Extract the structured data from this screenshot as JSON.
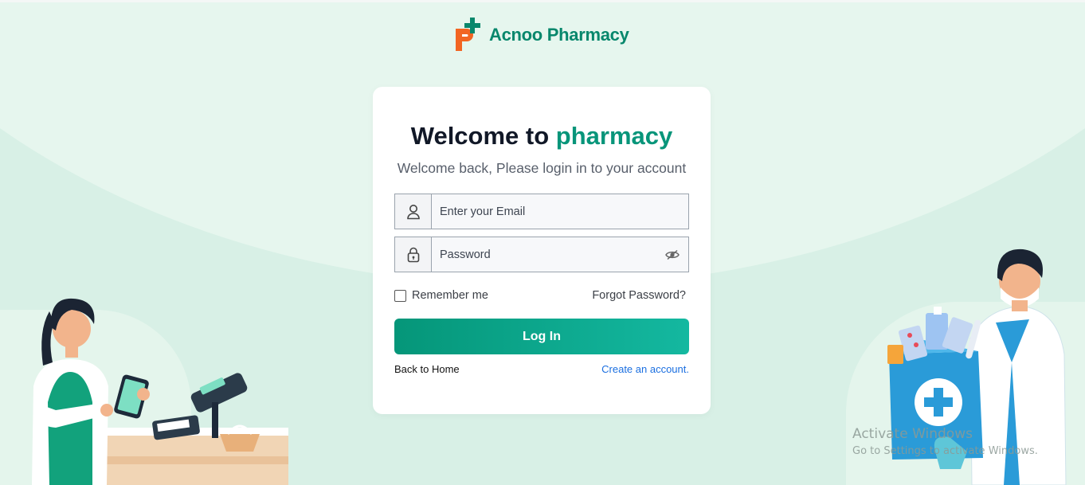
{
  "brand": {
    "name": "Acnoo Pharmacy",
    "logo_icon": "pharmacy-p-plus-logo"
  },
  "login": {
    "title_prefix": "Welcome to",
    "title_accent": "pharmacy",
    "subtitle": "Welcome back, Please login in to your account",
    "email_placeholder": "Enter your Email",
    "password_placeholder": "Password",
    "remember_label": "Remember me",
    "forgot_label": "Forgot Password?",
    "submit_label": "Log In",
    "back_home_label": "Back to Home",
    "create_account_label": "Create an account."
  },
  "icons": {
    "email_field": "user-icon",
    "password_field": "lock-icon",
    "toggle_password": "eye-icon"
  },
  "colors": {
    "brand_green": "#07876c",
    "button_start": "#059679",
    "button_end": "#14b8a0",
    "link_blue": "#1b6fe0",
    "background": "#d8f0e6"
  },
  "watermark": {
    "title": "Activate Windows",
    "subtitle": "Go to Settings to activate Windows."
  }
}
